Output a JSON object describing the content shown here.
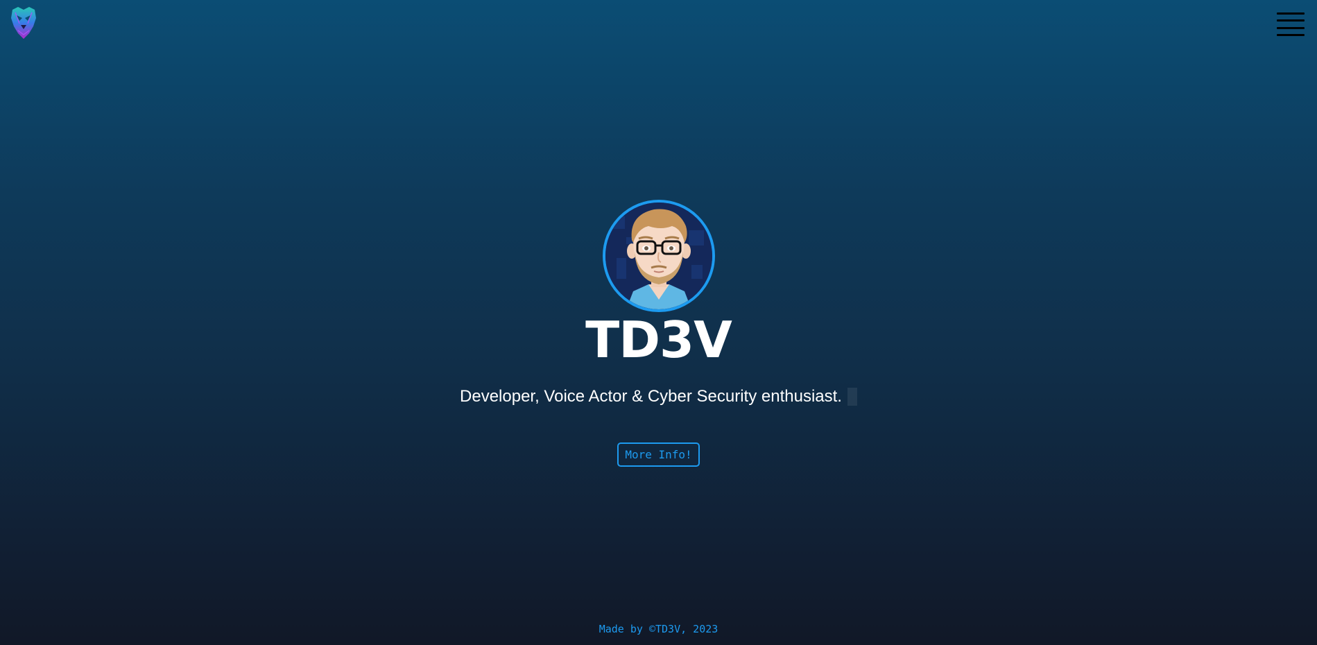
{
  "header": {
    "logo_icon": "tiger-head-logo-icon",
    "menu_icon": "hamburger-menu-icon"
  },
  "hero": {
    "avatar_icon": "avatar-illustration",
    "title": "TD3V",
    "subtitle": "Developer, Voice Actor & Cyber Security enthusiast.",
    "button_label": "More Info!"
  },
  "footer": {
    "text": "Made by ©TD3V, 2023"
  },
  "colors": {
    "accent": "#1d9bf0",
    "background_top": "#0b4d74",
    "background_bottom": "#111827",
    "text": "#ffffff"
  }
}
